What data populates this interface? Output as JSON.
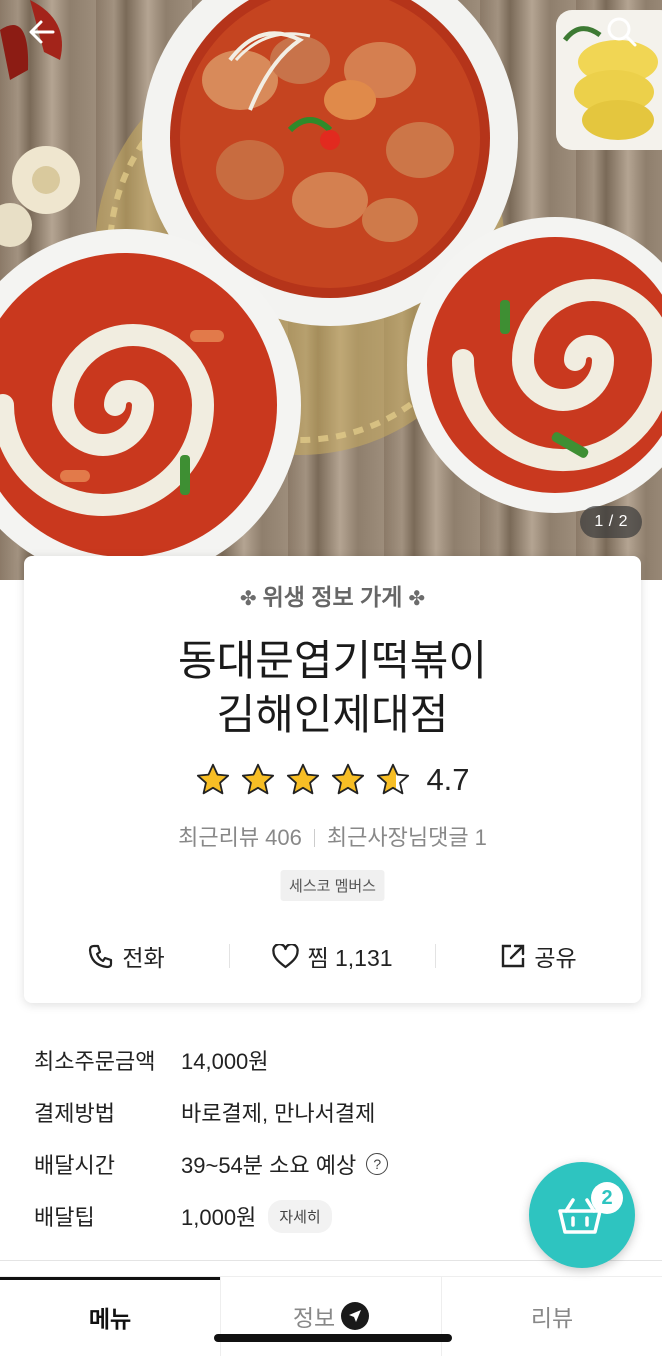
{
  "hero": {
    "image_counter": "1 / 2"
  },
  "store": {
    "hygiene_label": "위생 정보 가게",
    "name_line1": "동대문엽기떡볶이",
    "name_line2": "김해인제대점",
    "rating": 4.7,
    "rating_text": "4.7",
    "stars_filled": 4.7,
    "recent_reviews": "최근리뷰 406",
    "owner_replies": "최근사장님댓글 1",
    "badge": "세스코 멤버스"
  },
  "actions": {
    "call_label": "전화",
    "like_label": "찜 1,131",
    "share_label": "공유"
  },
  "delivery": {
    "rows": [
      {
        "key": "최소주문금액",
        "value": "14,000원"
      },
      {
        "key": "결제방법",
        "value": "바로결제, 만나서결제"
      },
      {
        "key": "배달시간",
        "value": "39~54분 소요 예상"
      },
      {
        "key": "배달팁",
        "value": "1,000원"
      }
    ],
    "tip_detail_label": "자세히"
  },
  "cart": {
    "count": "2",
    "color": "#2ec4c0"
  },
  "tabs": [
    {
      "label": "메뉴",
      "active": true
    },
    {
      "label": "정보",
      "active": false
    },
    {
      "label": "리뷰",
      "active": false
    }
  ]
}
